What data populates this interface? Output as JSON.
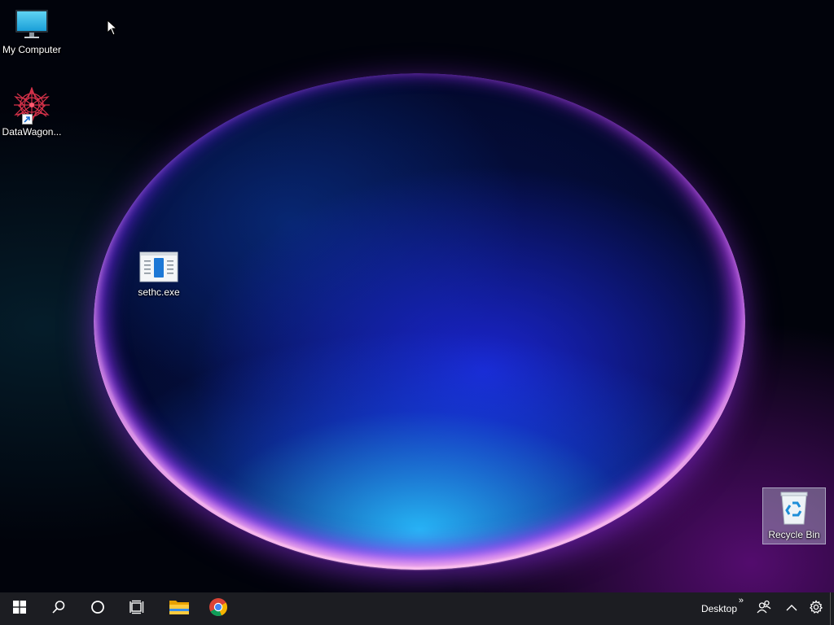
{
  "desktop": {
    "icons": [
      {
        "label": "My Computer",
        "icon": "monitor-icon"
      },
      {
        "label": "DataWagon...",
        "icon": "datawagon-app-icon"
      },
      {
        "label": "sethc.exe",
        "icon": "exe-file-icon"
      },
      {
        "label": "Recycle Bin",
        "icon": "recycle-bin-icon"
      }
    ]
  },
  "taskbar": {
    "buttons": [
      {
        "name": "start",
        "icon": "windows-logo-icon"
      },
      {
        "name": "search",
        "icon": "search-icon"
      },
      {
        "name": "cortana",
        "icon": "circle-icon"
      },
      {
        "name": "task-view",
        "icon": "task-view-icon"
      },
      {
        "name": "file-explorer",
        "icon": "folder-icon"
      },
      {
        "name": "chrome",
        "icon": "chrome-icon"
      }
    ],
    "toolbar_label": "Desktop",
    "toolbar_chevron": "»",
    "tray": [
      {
        "name": "people",
        "icon": "people-icon"
      },
      {
        "name": "show-hidden",
        "icon": "chevron-up-icon"
      },
      {
        "name": "settings",
        "icon": "gear-icon"
      }
    ]
  },
  "colors": {
    "taskbar": "#1c1d22",
    "orb_blue": "#1e2ae6",
    "orb_glow": "#a03cff"
  }
}
